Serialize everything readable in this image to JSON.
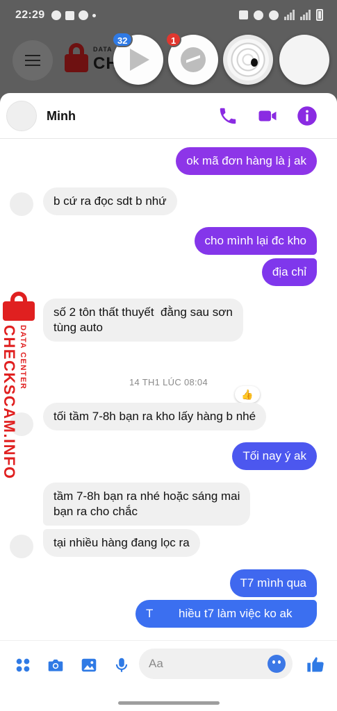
{
  "status_bar": {
    "time": "22:29"
  },
  "background_app": {
    "brand_small": "DATA",
    "brand_big": "CH"
  },
  "chat_heads": [
    {
      "name": "video-app",
      "badge": "32"
    },
    {
      "name": "messenger",
      "badge": "1"
    },
    {
      "name": "spider-web",
      "badge": ""
    },
    {
      "name": "blank",
      "badge": ""
    }
  ],
  "chat": {
    "contact_name": "Minh",
    "timestamp": "14 TH1 LÚC 08:04",
    "reaction": "👍",
    "messages": [
      {
        "side": "out",
        "text": "ok mã đơn hàng là j ak"
      },
      {
        "side": "in",
        "text": "b cứ ra đọc sdt b nhứ"
      },
      {
        "side": "out",
        "text": "cho mình lại đc kho"
      },
      {
        "side": "out",
        "text": "địa chỉ"
      },
      {
        "side": "in",
        "text_line1": "số 2 tôn thất thuyết  đằng sau sơn",
        "text_line2": "tùng auto"
      },
      {
        "side": "in",
        "text": "tối tầm 7-8h bạn ra kho lấy hàng b nhé"
      },
      {
        "side": "out",
        "text": "Tối nay ý ak"
      },
      {
        "side": "in",
        "text_line1": "tầm 7-8h bạn ra nhé hoặc sáng mai",
        "text_line2": "bạn ra cho chắc"
      },
      {
        "side": "in",
        "text": "tại nhiều hàng đang lọc ra"
      },
      {
        "side": "out",
        "text": "T7 mình qua"
      },
      {
        "side": "out",
        "text_left": "T",
        "text_right": "hiều t7 làm việc ko ak"
      }
    ]
  },
  "composer": {
    "placeholder": "Aa"
  },
  "watermark": {
    "line1": "DATA CENTER",
    "line2": "CHECKSCAM.INFO"
  },
  "colors": {
    "accent_purple": "#8a2be2",
    "bubble_purple": "#8d35e8",
    "bubble_blue": "#3d6ef0",
    "incoming": "#f0f0f0",
    "watermark_red": "#e02020"
  }
}
